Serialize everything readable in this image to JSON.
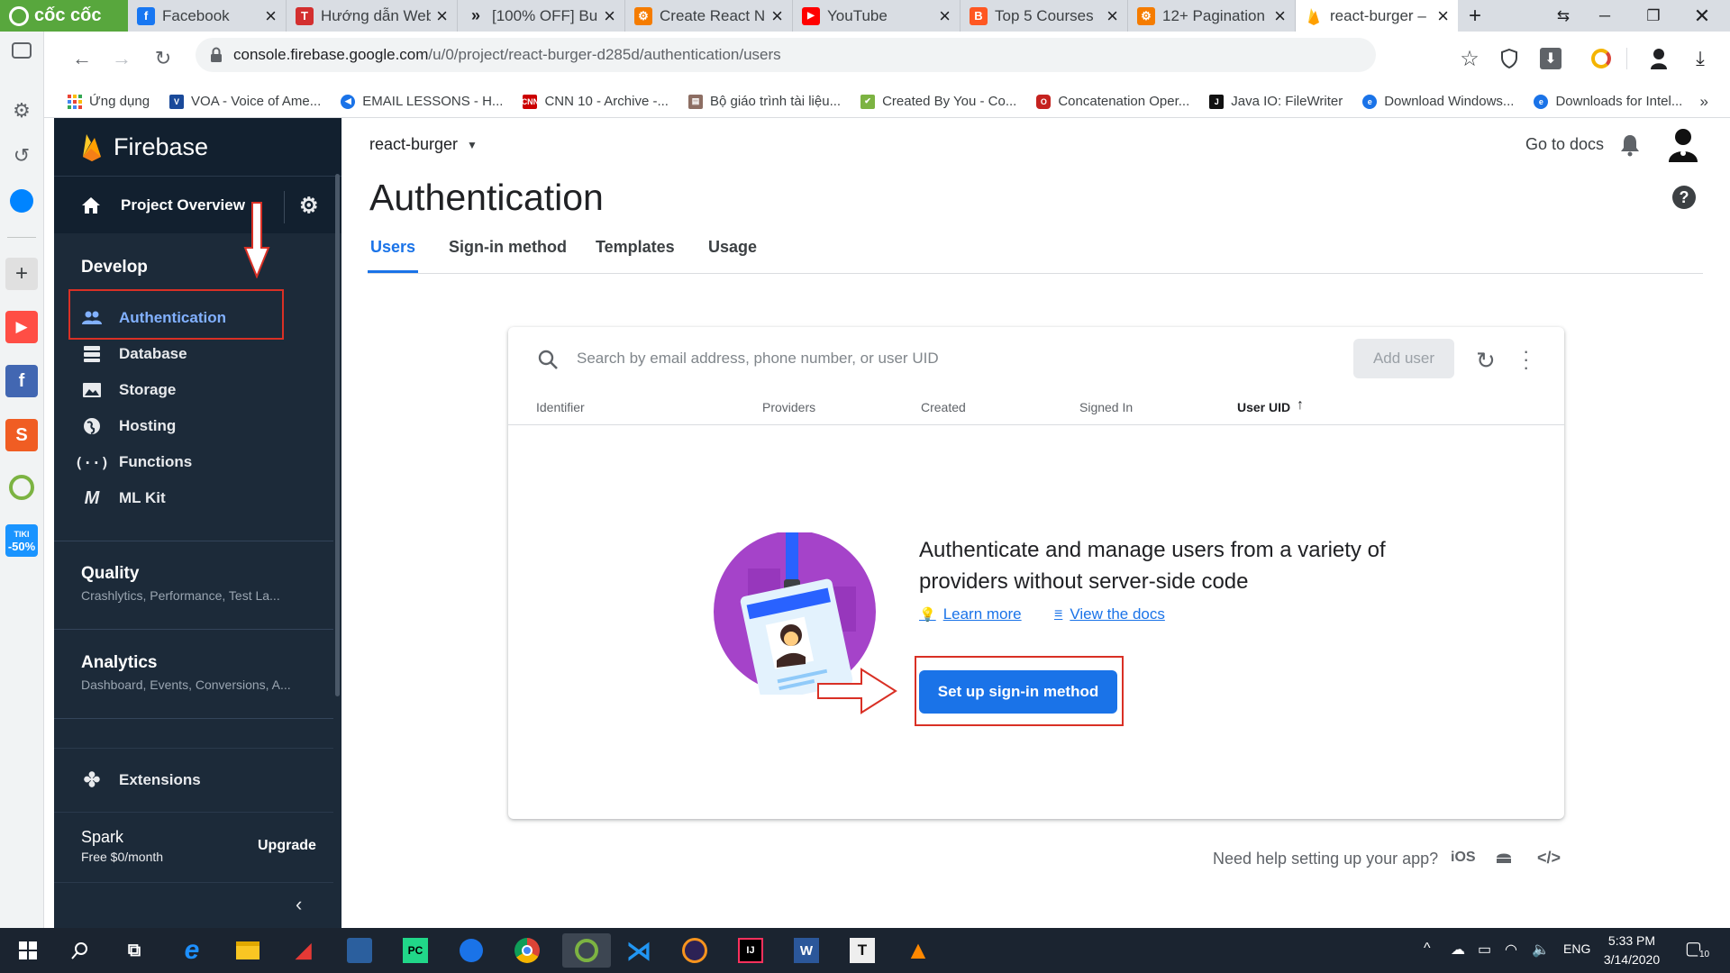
{
  "browser": {
    "name": "cốc cốc",
    "tabs": [
      {
        "title": "Facebook",
        "favicon": "facebook-icon"
      },
      {
        "title": "Hướng dẫn Web",
        "favicon": "t-icon"
      },
      {
        "title": "[100% OFF] Bu",
        "favicon": "chevrons-icon"
      },
      {
        "title": "Create React N",
        "favicon": "coursera-icon"
      },
      {
        "title": "YouTube",
        "favicon": "youtube-icon"
      },
      {
        "title": "Top 5 Courses",
        "favicon": "blogger-icon"
      },
      {
        "title": "12+ Pagination",
        "favicon": "coursera-icon"
      },
      {
        "title": "react-burger –",
        "favicon": "firebase-icon"
      }
    ],
    "url_host": "console.firebase.google.com",
    "url_path": "/u/0/project/react-burger-d285d/authentication/users",
    "bookmarks": [
      {
        "label": "Ứng dụng",
        "color": "#ea4335"
      },
      {
        "label": "VOA - Voice of Ame...",
        "color": "#1a4a9a"
      },
      {
        "label": "EMAIL LESSONS - H...",
        "color": "#1a73e8"
      },
      {
        "label": "CNN 10 - Archive -...",
        "color": "#cc0000"
      },
      {
        "label": "Bộ giáo trình tài liệu...",
        "color": "#8d6e63"
      },
      {
        "label": "Created By You - Co...",
        "color": "#7cb342"
      },
      {
        "label": "Concatenation Oper...",
        "color": "#c5221f"
      },
      {
        "label": "Java IO: FileWriter",
        "color": "#111111"
      },
      {
        "label": "Download Windows...",
        "color": "#1a73e8"
      },
      {
        "label": "Downloads for Intel...",
        "color": "#1a73e8"
      }
    ],
    "more_bookmarks": "»"
  },
  "rail_badge": "-50%",
  "rail_badge_top": "TIKI",
  "sidebar": {
    "brand": "Firebase",
    "project_overview": "Project Overview",
    "develop_title": "Develop",
    "develop_items": [
      {
        "label": "Authentication",
        "icon": "people-icon"
      },
      {
        "label": "Database",
        "icon": "database-icon"
      },
      {
        "label": "Storage",
        "icon": "image-icon"
      },
      {
        "label": "Hosting",
        "icon": "globe-icon"
      },
      {
        "label": "Functions",
        "icon": "functions-icon"
      },
      {
        "label": "ML Kit",
        "icon": "mlkit-icon"
      }
    ],
    "quality_title": "Quality",
    "quality_sub": "Crashlytics, Performance, Test La...",
    "analytics_title": "Analytics",
    "analytics_sub": "Dashboard, Events, Conversions, A...",
    "extensions": "Extensions",
    "plan_name": "Spark",
    "plan_price": "Free $0/month",
    "upgrade": "Upgrade"
  },
  "main": {
    "project_name": "react-burger",
    "go_to_docs": "Go to docs",
    "title": "Authentication",
    "tabs": [
      "Users",
      "Sign-in method",
      "Templates",
      "Usage"
    ],
    "active_tab": 0,
    "search_placeholder": "Search by email address, phone number, or user UID",
    "add_user": "Add user",
    "columns": [
      "Identifier",
      "Providers",
      "Created",
      "Signed In",
      "User UID"
    ],
    "sorted_column": "User UID",
    "empty_heading": "Authenticate and manage users from a variety of providers without server-side code",
    "learn_more": "Learn more",
    "view_docs": "View the docs",
    "setup_button": "Set up sign-in method",
    "help_text": "Need help setting up your app?",
    "help_ios": "iOS"
  },
  "taskbar": {
    "lang": "ENG",
    "time": "5:33 PM",
    "date": "3/14/2020",
    "notif_count": "10"
  },
  "colors": {
    "sidebar_bg": "#1c2a39",
    "accent": "#1a73e8",
    "annotation_red": "#d93025",
    "firebase_orange": "#ffa000"
  }
}
